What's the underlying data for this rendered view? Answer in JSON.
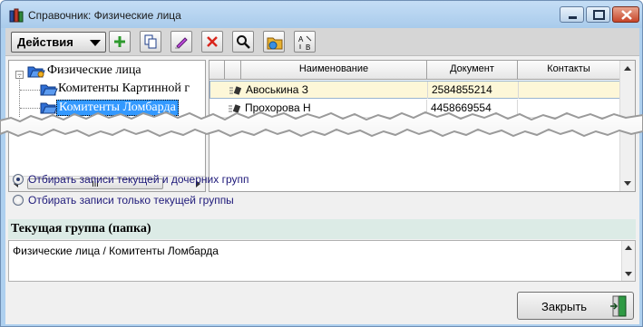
{
  "window": {
    "title": "Справочник: Физические лица"
  },
  "toolbar": {
    "actions_label": "Действия",
    "buttons": [
      "add-icon",
      "copy-icon",
      "edit-icon",
      "delete-icon",
      "search-icon",
      "refresh-icon",
      "sort-icon"
    ]
  },
  "tree": {
    "root_label": "Физические лица",
    "items": [
      {
        "label": "Комитенты Картинной г"
      },
      {
        "label": "Комитенты Ломбарда"
      }
    ]
  },
  "grid": {
    "columns": [
      "Наименование",
      "Документ",
      "Контакты"
    ],
    "rows": [
      {
        "name": "Авоськина З",
        "document": "2584855214",
        "contacts": ""
      },
      {
        "name": "Прохорова Н",
        "document": "4458669554",
        "contacts": ""
      }
    ]
  },
  "scroll": {
    "h_thumb_label": "III"
  },
  "filters": {
    "option1": "Отбирать записи текущей и дочерних групп",
    "option2": "Отбирать записи только текущей группы",
    "selected": 1
  },
  "current_group": {
    "header": "Текущая группа (папка)",
    "path": "Физические лица / Комитенты Ломбарда"
  },
  "footer": {
    "close_label": "Закрыть"
  },
  "colors": {
    "selection": "#3399ff",
    "row_highlight": "#fdf7d8",
    "group_header_bg": "#dcebe6"
  }
}
